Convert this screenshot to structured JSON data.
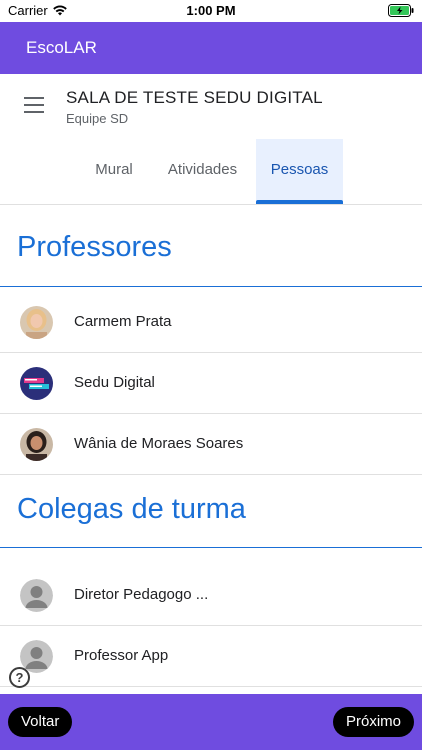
{
  "status_bar": {
    "carrier": "Carrier",
    "time": "1:00 PM"
  },
  "app_bar": {
    "title": "EscoLAR"
  },
  "class": {
    "name": "SALA DE TESTE SEDU DIGITAL",
    "team": "Equipe SD"
  },
  "tabs": [
    {
      "label": "Mural",
      "active": false
    },
    {
      "label": "Atividades",
      "active": false
    },
    {
      "label": "Pessoas",
      "active": true
    }
  ],
  "teachers": {
    "title": "Professores",
    "people": [
      {
        "name": "Carmem Prata",
        "avatar": "photo-avatar"
      },
      {
        "name": "Sedu Digital",
        "avatar": "logo-avatar"
      },
      {
        "name": "Wânia de Moraes Soares",
        "avatar": "photo-avatar"
      }
    ]
  },
  "classmates": {
    "title": "Colegas de turma",
    "people": [
      {
        "name": "Diretor Pedagogo ...",
        "avatar": "default-avatar"
      },
      {
        "name": "Professor App",
        "avatar": "default-avatar"
      }
    ]
  },
  "help": {
    "icon": "help-icon",
    "glyph": "?"
  },
  "bottom_bar": {
    "back_label": "Voltar",
    "next_label": "Próximo"
  },
  "colors": {
    "brand": "#6f4ce0",
    "accent": "#1a6fd6"
  }
}
